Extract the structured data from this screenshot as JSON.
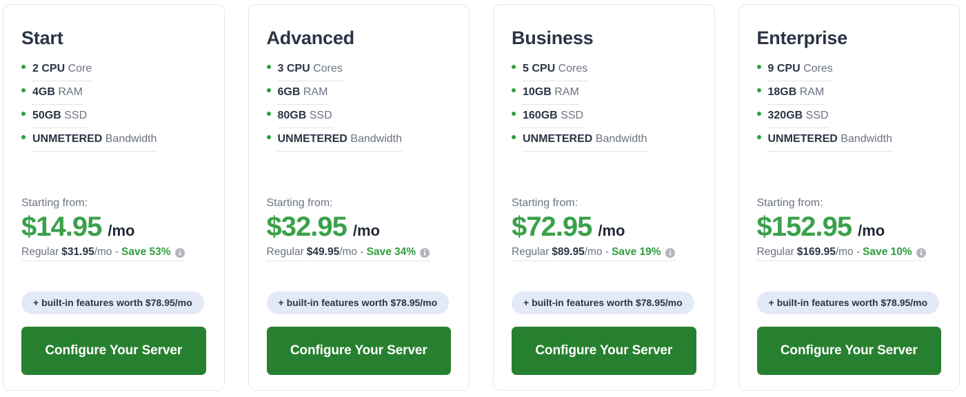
{
  "plans": [
    {
      "name": "Start",
      "specs": [
        {
          "strong": "2 CPU",
          "rest": " Core"
        },
        {
          "strong": "4GB",
          "rest": " RAM"
        },
        {
          "strong": "50GB",
          "rest": " SSD"
        },
        {
          "strong": "UNMETERED",
          "rest": " Bandwidth"
        }
      ],
      "starting_label": "Starting from:",
      "price": "$14.95",
      "period": "/mo",
      "regular_prefix": "Regular",
      "regular_price": "$31.95",
      "regular_suffix": "/mo -",
      "save_text": "Save 53%",
      "info_icon": "info-icon",
      "features_badge": "+ built-in features worth $78.95/mo",
      "cta_label": "Configure Your Server"
    },
    {
      "name": "Advanced",
      "specs": [
        {
          "strong": "3 CPU",
          "rest": " Cores"
        },
        {
          "strong": "6GB",
          "rest": " RAM"
        },
        {
          "strong": "80GB",
          "rest": " SSD"
        },
        {
          "strong": "UNMETERED",
          "rest": " Bandwidth"
        }
      ],
      "starting_label": "Starting from:",
      "price": "$32.95",
      "period": "/mo",
      "regular_prefix": "Regular",
      "regular_price": "$49.95",
      "regular_suffix": "/mo -",
      "save_text": "Save 34%",
      "info_icon": "info-icon",
      "features_badge": "+ built-in features worth $78.95/mo",
      "cta_label": "Configure Your Server"
    },
    {
      "name": "Business",
      "specs": [
        {
          "strong": "5 CPU",
          "rest": " Cores"
        },
        {
          "strong": "10GB",
          "rest": " RAM"
        },
        {
          "strong": "160GB",
          "rest": " SSD"
        },
        {
          "strong": "UNMETERED",
          "rest": " Bandwidth"
        }
      ],
      "starting_label": "Starting from:",
      "price": "$72.95",
      "period": "/mo",
      "regular_prefix": "Regular",
      "regular_price": "$89.95",
      "regular_suffix": "/mo -",
      "save_text": "Save 19%",
      "info_icon": "info-icon",
      "features_badge": "+ built-in features worth $78.95/mo",
      "cta_label": "Configure Your Server"
    },
    {
      "name": "Enterprise",
      "specs": [
        {
          "strong": "9 CPU",
          "rest": " Cores"
        },
        {
          "strong": "18GB",
          "rest": " RAM"
        },
        {
          "strong": "320GB",
          "rest": " SSD"
        },
        {
          "strong": "UNMETERED",
          "rest": " Bandwidth"
        }
      ],
      "starting_label": "Starting from:",
      "price": "$152.95",
      "period": "/mo",
      "regular_prefix": "Regular",
      "regular_price": "$169.95",
      "regular_suffix": "/mo -",
      "save_text": "Save 10%",
      "info_icon": "info-icon",
      "features_badge": "+ built-in features worth $78.95/mo",
      "cta_label": "Configure Your Server"
    }
  ],
  "colors": {
    "price_green": "#3aa14a",
    "button_green": "#27802f",
    "save_green": "#2e9e3e",
    "bullet_green": "#2e9e3e",
    "heading_navy": "#2b3445",
    "muted_gray": "#6b7280",
    "badge_bg": "#e3e9f7",
    "card_border": "#e4e4ee",
    "info_icon_gray": "#b3b7bd"
  }
}
